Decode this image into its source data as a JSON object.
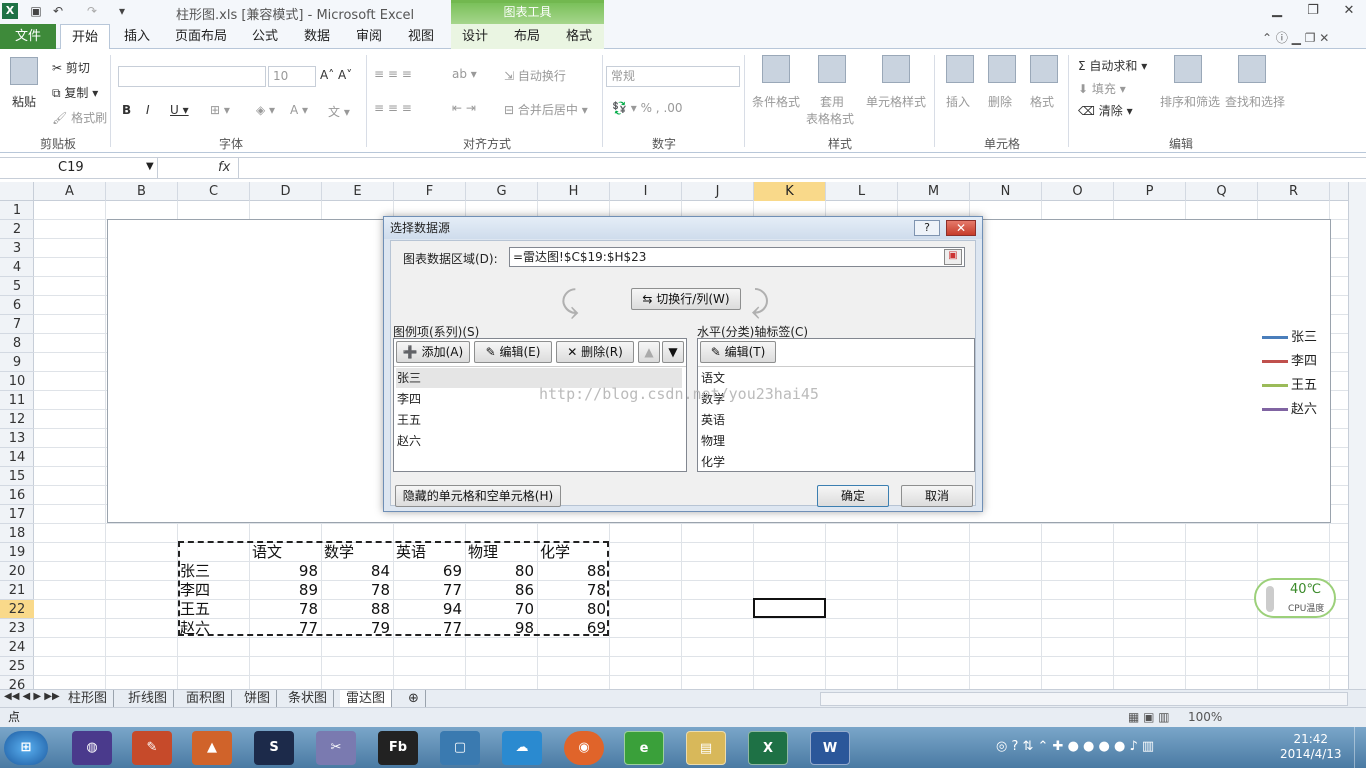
{
  "window": {
    "doc_title": "柱形图.xls  [兼容模式]  -  Microsoft Excel",
    "context_tab_group": "图表工具"
  },
  "tabs": [
    "文件",
    "开始",
    "插入",
    "页面布局",
    "公式",
    "数据",
    "审阅",
    "视图",
    "设计",
    "布局",
    "格式"
  ],
  "ribbon": {
    "clipboard": {
      "paste": "粘贴",
      "cut": "剪切",
      "copy": "复制",
      "format_painter": "格式刷",
      "label": "剪贴板"
    },
    "font": {
      "size": "10",
      "label": "字体"
    },
    "alignment": {
      "wrap": "自动换行",
      "merge": "合并后居中",
      "label": "对齐方式"
    },
    "number": {
      "format": "常规",
      "label": "数字"
    },
    "styles": {
      "cond": "条件格式",
      "table": "套用",
      "table2": "表格格式",
      "cell": "单元格样式",
      "label": "样式"
    },
    "cells": {
      "insert": "插入",
      "delete": "删除",
      "format": "格式",
      "label": "单元格"
    },
    "editing": {
      "autosum": "自动求和",
      "fill": "填充",
      "clear": "清除",
      "sort": "排序和筛选",
      "find": "查找和选择",
      "label": "编辑"
    }
  },
  "formula_bar": {
    "name_box": "C19",
    "fx": "fx"
  },
  "columns": [
    "A",
    "B",
    "C",
    "D",
    "E",
    "F",
    "G",
    "H",
    "I",
    "J",
    "K",
    "L",
    "M",
    "N",
    "O",
    "P",
    "Q",
    "R"
  ],
  "selected_column": "K",
  "rows": [
    "1",
    "2",
    "3",
    "4",
    "5",
    "6",
    "7",
    "8",
    "9",
    "10",
    "11",
    "12",
    "13",
    "14",
    "15",
    "16",
    "17",
    "18",
    "19",
    "20",
    "21",
    "22",
    "23",
    "24",
    "25",
    "26"
  ],
  "selected_row": "22",
  "table": {
    "headers": [
      "语文",
      "数学",
      "英语",
      "物理",
      "化学"
    ],
    "rows": [
      {
        "name": "张三",
        "values": [
          "98",
          "84",
          "69",
          "80",
          "88"
        ]
      },
      {
        "name": "李四",
        "values": [
          "89",
          "78",
          "77",
          "86",
          "78"
        ]
      },
      {
        "name": "王五",
        "values": [
          "78",
          "88",
          "94",
          "70",
          "80"
        ]
      },
      {
        "name": "赵六",
        "values": [
          "77",
          "79",
          "77",
          "98",
          "69"
        ]
      }
    ]
  },
  "chart_legend": [
    {
      "name": "张三",
      "color": "#4a7ebb"
    },
    {
      "name": "李四",
      "color": "#c0504d"
    },
    {
      "name": "王五",
      "color": "#9bbb59"
    },
    {
      "name": "赵六",
      "color": "#8064a2"
    }
  ],
  "dialog": {
    "title": "选择数据源",
    "help": "?",
    "close": "✕",
    "range_label": "图表数据区域(D):",
    "range_value": "=雷达图!$C$19:$H$23",
    "switch_btn": "切换行/列(W)",
    "series_label": "图例项(系列)(S)",
    "add_btn": "添加(A)",
    "edit_btn": "编辑(E)",
    "delete_btn": "删除(R)",
    "series": [
      "张三",
      "李四",
      "王五",
      "赵六"
    ],
    "axis_label": "水平(分类)轴标签(C)",
    "axis_edit_btn": "编辑(T)",
    "categories": [
      "语文",
      "数学",
      "英语",
      "物理",
      "化学"
    ],
    "hidden_btn": "隐藏的单元格和空单元格(H)",
    "ok_btn": "确定",
    "cancel_btn": "取消",
    "watermark": "http://blog.csdn.net/you23hai45"
  },
  "sheet_tabs": [
    "柱形图",
    "折线图",
    "面积图",
    "饼图",
    "条状图",
    "雷达图"
  ],
  "active_sheet": "雷达图",
  "status": {
    "mode": "点",
    "zoom": "100%"
  },
  "temp_widget": {
    "value": "40℃",
    "label": "CPU温度"
  },
  "clock": {
    "time": "21:42",
    "date": "2014/4/13"
  }
}
